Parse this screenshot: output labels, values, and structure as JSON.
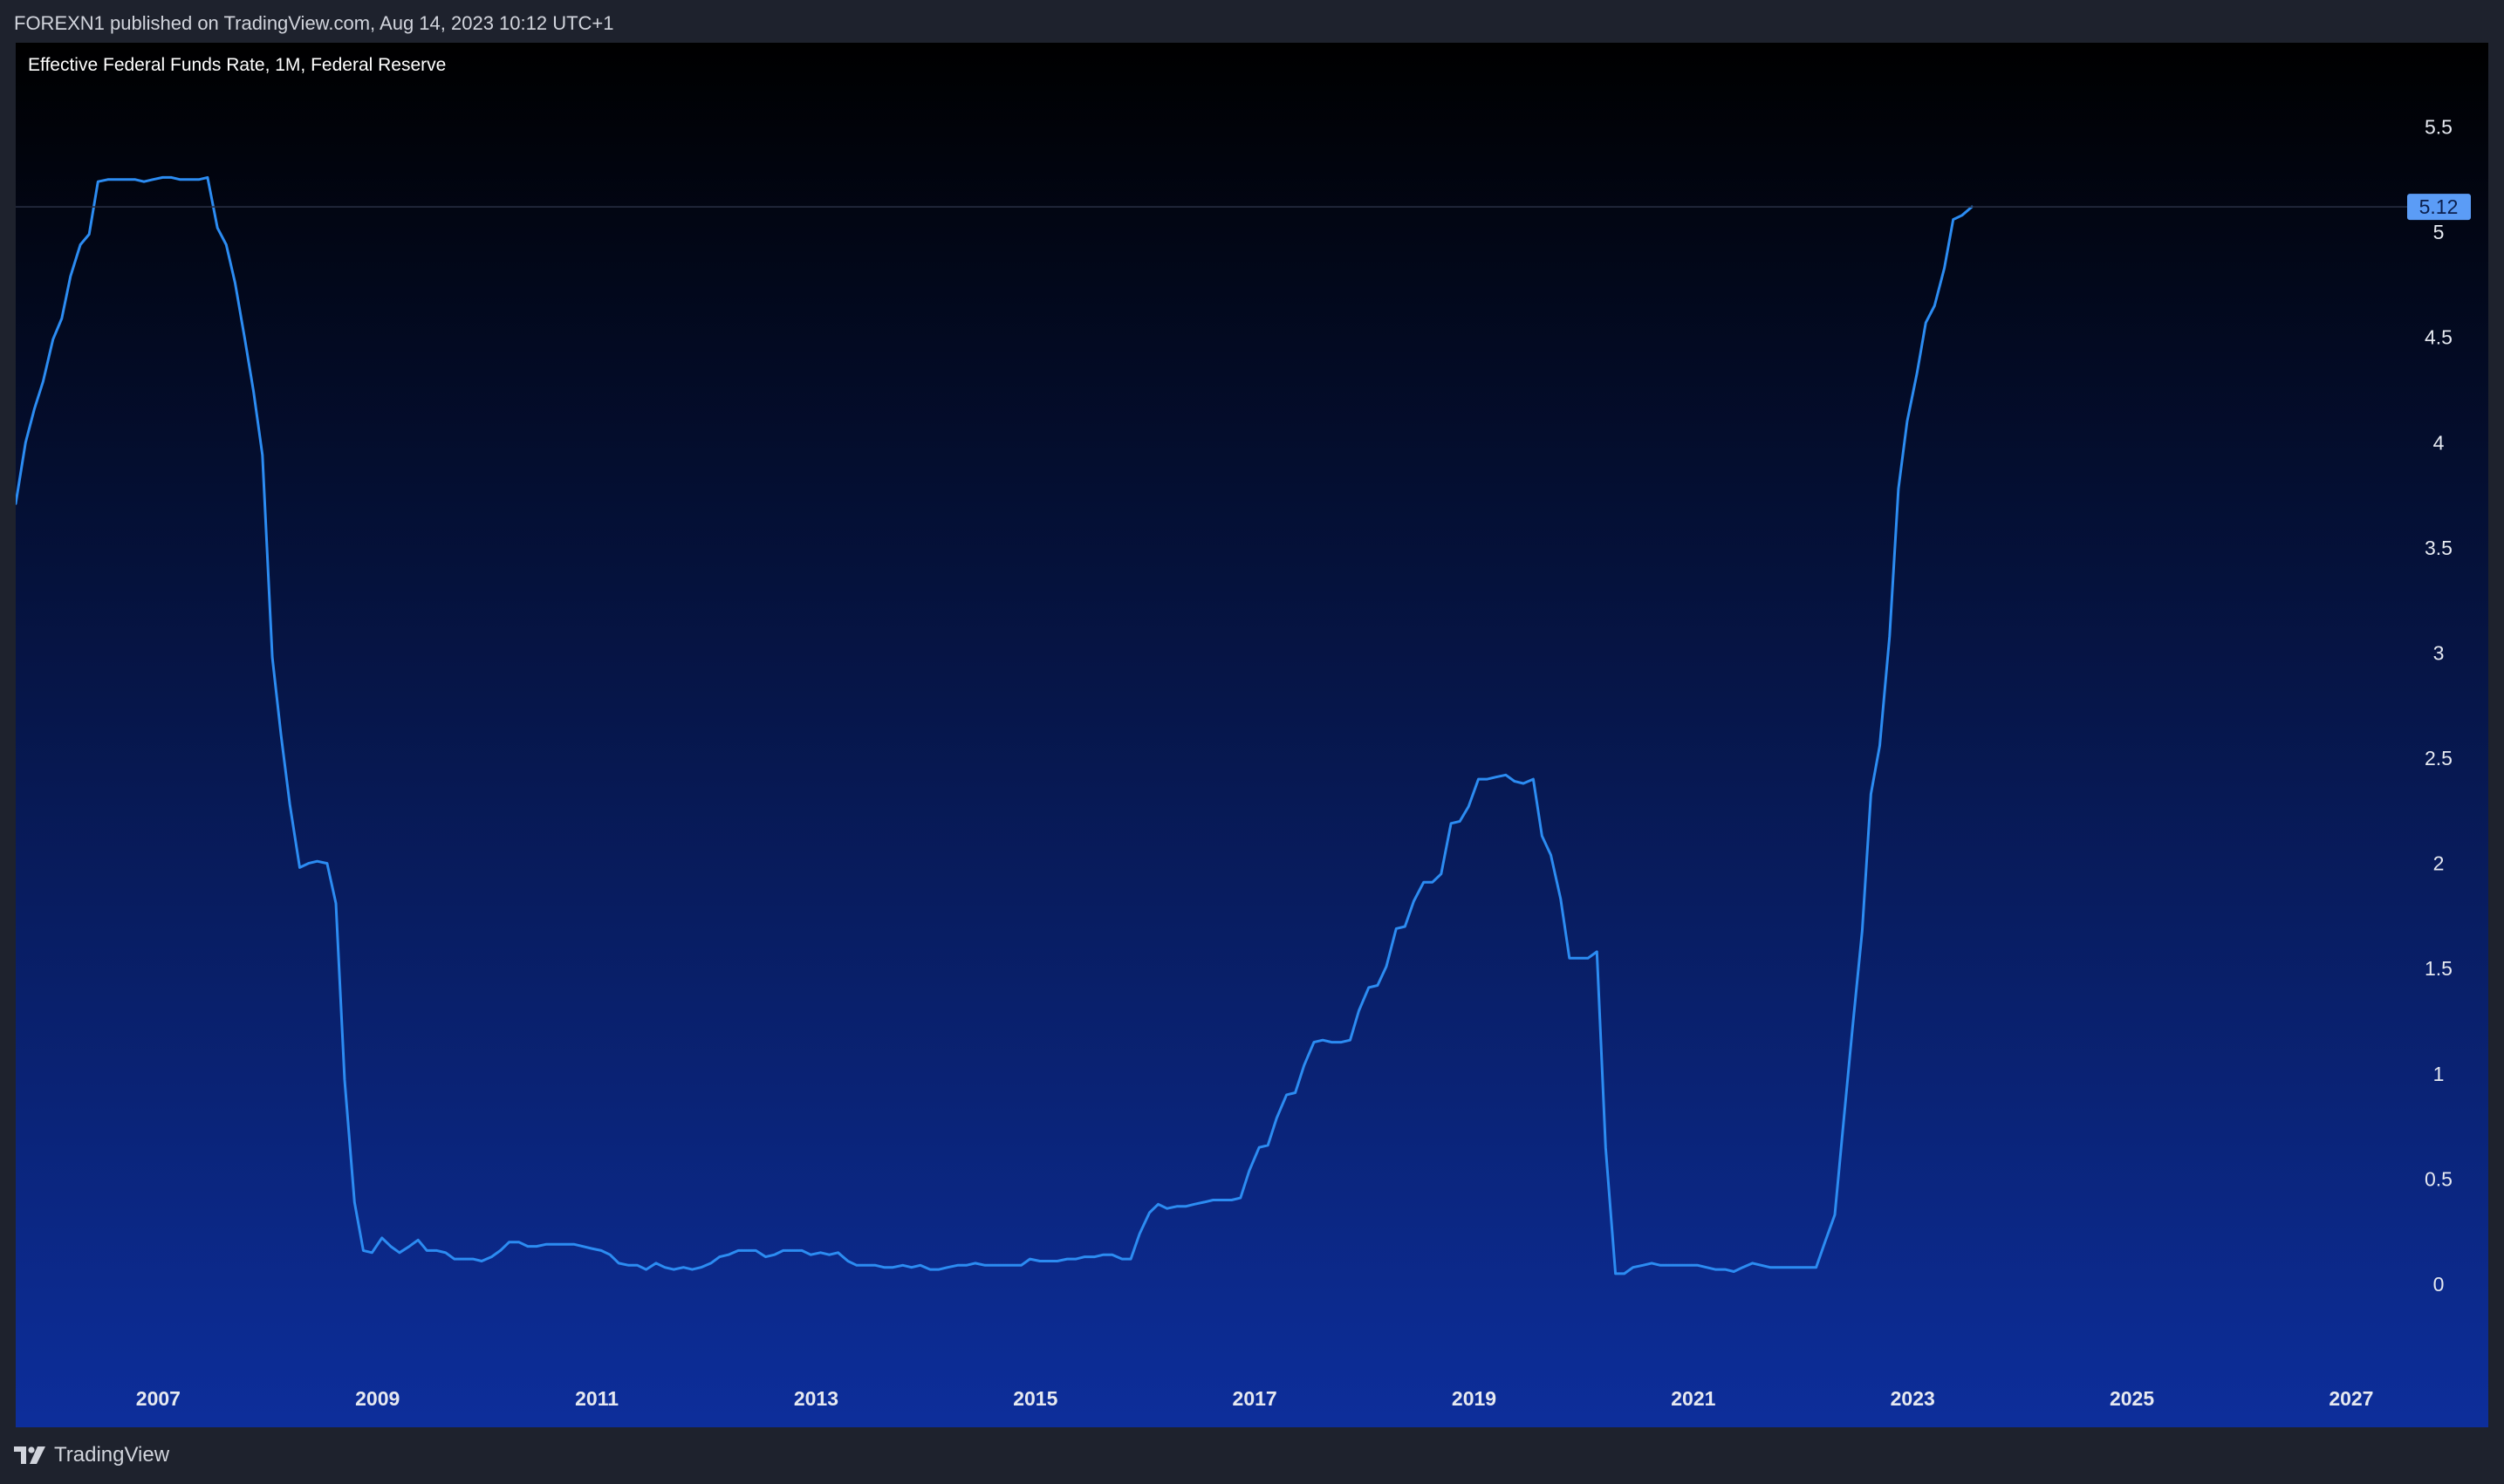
{
  "header": {
    "publish_text": "FOREXN1 published on TradingView.com, Aug 14, 2023 10:12 UTC+1"
  },
  "footer": {
    "brand": "TradingView",
    "logo_mark": "TV"
  },
  "colors": {
    "background_top": "#000000",
    "background_bottom": "#0d2e9b",
    "line": "#2c8cf2",
    "axis_text": "#e6e9f0",
    "price_label_bg": "#5b9cf6",
    "price_label_text": "#0b1f4d",
    "frame": "#1e222d"
  },
  "chart_data": {
    "type": "line",
    "title": "Effective Federal Funds Rate, 1M, Federal Reserve",
    "xlabel": "",
    "ylabel": "",
    "x_ticks": [
      "2007",
      "2009",
      "2011",
      "2013",
      "2015",
      "2017",
      "2019",
      "2021",
      "2023",
      "2025",
      "2027"
    ],
    "y_ticks": [
      "0",
      "0.5",
      "1",
      "1.5",
      "2",
      "2.5",
      "3",
      "3.5",
      "4",
      "4.5",
      "5",
      "5.5"
    ],
    "xlim": [
      2005.7,
      2028.25
    ],
    "ylim": [
      -0.68,
      5.9
    ],
    "last_value_label": "5.12",
    "last_value": 5.12,
    "grid": false,
    "series": [
      {
        "points": [
          [
            2005.7,
            3.71
          ],
          [
            2005.79,
            4.0
          ],
          [
            2005.87,
            4.16
          ],
          [
            2005.95,
            4.29
          ],
          [
            2006.04,
            4.49
          ],
          [
            2006.12,
            4.59
          ],
          [
            2006.2,
            4.79
          ],
          [
            2006.29,
            4.94
          ],
          [
            2006.37,
            4.99
          ],
          [
            2006.45,
            5.24
          ],
          [
            2006.54,
            5.25
          ],
          [
            2006.62,
            5.25
          ],
          [
            2006.7,
            5.25
          ],
          [
            2006.79,
            5.25
          ],
          [
            2006.87,
            5.24
          ],
          [
            2006.95,
            5.25
          ],
          [
            2007.04,
            5.26
          ],
          [
            2007.12,
            5.26
          ],
          [
            2007.2,
            5.25
          ],
          [
            2007.29,
            5.25
          ],
          [
            2007.37,
            5.25
          ],
          [
            2007.45,
            5.26
          ],
          [
            2007.54,
            5.02
          ],
          [
            2007.62,
            4.94
          ],
          [
            2007.7,
            4.76
          ],
          [
            2007.79,
            4.49
          ],
          [
            2007.87,
            4.24
          ],
          [
            2007.95,
            3.94
          ],
          [
            2008.04,
            2.98
          ],
          [
            2008.12,
            2.61
          ],
          [
            2008.2,
            2.28
          ],
          [
            2008.29,
            1.98
          ],
          [
            2008.37,
            2.0
          ],
          [
            2008.45,
            2.01
          ],
          [
            2008.54,
            2.0
          ],
          [
            2008.62,
            1.81
          ],
          [
            2008.7,
            0.97
          ],
          [
            2008.79,
            0.39
          ],
          [
            2008.87,
            0.16
          ],
          [
            2008.95,
            0.15
          ],
          [
            2009.04,
            0.22
          ],
          [
            2009.12,
            0.18
          ],
          [
            2009.2,
            0.15
          ],
          [
            2009.29,
            0.18
          ],
          [
            2009.37,
            0.21
          ],
          [
            2009.45,
            0.16
          ],
          [
            2009.54,
            0.16
          ],
          [
            2009.62,
            0.15
          ],
          [
            2009.7,
            0.12
          ],
          [
            2009.79,
            0.12
          ],
          [
            2009.87,
            0.12
          ],
          [
            2009.95,
            0.11
          ],
          [
            2010.04,
            0.13
          ],
          [
            2010.12,
            0.16
          ],
          [
            2010.2,
            0.2
          ],
          [
            2010.29,
            0.2
          ],
          [
            2010.37,
            0.18
          ],
          [
            2010.45,
            0.18
          ],
          [
            2010.54,
            0.19
          ],
          [
            2010.62,
            0.19
          ],
          [
            2010.7,
            0.19
          ],
          [
            2010.79,
            0.19
          ],
          [
            2010.87,
            0.18
          ],
          [
            2010.95,
            0.17
          ],
          [
            2011.04,
            0.16
          ],
          [
            2011.12,
            0.14
          ],
          [
            2011.2,
            0.1
          ],
          [
            2011.29,
            0.09
          ],
          [
            2011.37,
            0.09
          ],
          [
            2011.45,
            0.07
          ],
          [
            2011.54,
            0.1
          ],
          [
            2011.62,
            0.08
          ],
          [
            2011.7,
            0.07
          ],
          [
            2011.79,
            0.08
          ],
          [
            2011.87,
            0.07
          ],
          [
            2011.95,
            0.08
          ],
          [
            2012.04,
            0.1
          ],
          [
            2012.12,
            0.13
          ],
          [
            2012.2,
            0.14
          ],
          [
            2012.29,
            0.16
          ],
          [
            2012.37,
            0.16
          ],
          [
            2012.45,
            0.16
          ],
          [
            2012.54,
            0.13
          ],
          [
            2012.62,
            0.14
          ],
          [
            2012.7,
            0.16
          ],
          [
            2012.79,
            0.16
          ],
          [
            2012.87,
            0.16
          ],
          [
            2012.95,
            0.14
          ],
          [
            2013.04,
            0.15
          ],
          [
            2013.12,
            0.14
          ],
          [
            2013.2,
            0.15
          ],
          [
            2013.29,
            0.11
          ],
          [
            2013.37,
            0.09
          ],
          [
            2013.45,
            0.09
          ],
          [
            2013.54,
            0.09
          ],
          [
            2013.62,
            0.08
          ],
          [
            2013.7,
            0.08
          ],
          [
            2013.79,
            0.09
          ],
          [
            2013.87,
            0.08
          ],
          [
            2013.95,
            0.09
          ],
          [
            2014.04,
            0.07
          ],
          [
            2014.12,
            0.07
          ],
          [
            2014.2,
            0.08
          ],
          [
            2014.29,
            0.09
          ],
          [
            2014.37,
            0.09
          ],
          [
            2014.45,
            0.1
          ],
          [
            2014.54,
            0.09
          ],
          [
            2014.62,
            0.09
          ],
          [
            2014.7,
            0.09
          ],
          [
            2014.79,
            0.09
          ],
          [
            2014.87,
            0.09
          ],
          [
            2014.95,
            0.12
          ],
          [
            2015.04,
            0.11
          ],
          [
            2015.12,
            0.11
          ],
          [
            2015.2,
            0.11
          ],
          [
            2015.29,
            0.12
          ],
          [
            2015.37,
            0.12
          ],
          [
            2015.45,
            0.13
          ],
          [
            2015.54,
            0.13
          ],
          [
            2015.62,
            0.14
          ],
          [
            2015.7,
            0.14
          ],
          [
            2015.79,
            0.12
          ],
          [
            2015.87,
            0.12
          ],
          [
            2015.95,
            0.24
          ],
          [
            2016.04,
            0.34
          ],
          [
            2016.12,
            0.38
          ],
          [
            2016.2,
            0.36
          ],
          [
            2016.29,
            0.37
          ],
          [
            2016.37,
            0.37
          ],
          [
            2016.45,
            0.38
          ],
          [
            2016.54,
            0.39
          ],
          [
            2016.62,
            0.4
          ],
          [
            2016.7,
            0.4
          ],
          [
            2016.79,
            0.4
          ],
          [
            2016.87,
            0.41
          ],
          [
            2016.95,
            0.54
          ],
          [
            2017.04,
            0.65
          ],
          [
            2017.12,
            0.66
          ],
          [
            2017.2,
            0.79
          ],
          [
            2017.29,
            0.9
          ],
          [
            2017.37,
            0.91
          ],
          [
            2017.45,
            1.04
          ],
          [
            2017.54,
            1.15
          ],
          [
            2017.62,
            1.16
          ],
          [
            2017.7,
            1.15
          ],
          [
            2017.79,
            1.15
          ],
          [
            2017.87,
            1.16
          ],
          [
            2017.95,
            1.3
          ],
          [
            2018.04,
            1.41
          ],
          [
            2018.12,
            1.42
          ],
          [
            2018.2,
            1.51
          ],
          [
            2018.29,
            1.69
          ],
          [
            2018.37,
            1.7
          ],
          [
            2018.45,
            1.82
          ],
          [
            2018.54,
            1.91
          ],
          [
            2018.62,
            1.91
          ],
          [
            2018.7,
            1.95
          ],
          [
            2018.79,
            2.19
          ],
          [
            2018.87,
            2.2
          ],
          [
            2018.95,
            2.27
          ],
          [
            2019.04,
            2.4
          ],
          [
            2019.12,
            2.4
          ],
          [
            2019.2,
            2.41
          ],
          [
            2019.29,
            2.42
          ],
          [
            2019.37,
            2.39
          ],
          [
            2019.45,
            2.38
          ],
          [
            2019.54,
            2.4
          ],
          [
            2019.62,
            2.13
          ],
          [
            2019.7,
            2.04
          ],
          [
            2019.79,
            1.83
          ],
          [
            2019.87,
            1.55
          ],
          [
            2019.95,
            1.55
          ],
          [
            2020.04,
            1.55
          ],
          [
            2020.12,
            1.58
          ],
          [
            2020.2,
            0.65
          ],
          [
            2020.29,
            0.05
          ],
          [
            2020.37,
            0.05
          ],
          [
            2020.45,
            0.08
          ],
          [
            2020.54,
            0.09
          ],
          [
            2020.62,
            0.1
          ],
          [
            2020.7,
            0.09
          ],
          [
            2020.79,
            0.09
          ],
          [
            2020.87,
            0.09
          ],
          [
            2020.95,
            0.09
          ],
          [
            2021.04,
            0.09
          ],
          [
            2021.12,
            0.08
          ],
          [
            2021.2,
            0.07
          ],
          [
            2021.29,
            0.07
          ],
          [
            2021.37,
            0.06
          ],
          [
            2021.45,
            0.08
          ],
          [
            2021.54,
            0.1
          ],
          [
            2021.62,
            0.09
          ],
          [
            2021.7,
            0.08
          ],
          [
            2021.79,
            0.08
          ],
          [
            2021.87,
            0.08
          ],
          [
            2021.95,
            0.08
          ],
          [
            2022.04,
            0.08
          ],
          [
            2022.12,
            0.08
          ],
          [
            2022.2,
            0.2
          ],
          [
            2022.29,
            0.33
          ],
          [
            2022.37,
            0.77
          ],
          [
            2022.45,
            1.21
          ],
          [
            2022.54,
            1.68
          ],
          [
            2022.62,
            2.33
          ],
          [
            2022.7,
            2.56
          ],
          [
            2022.79,
            3.08
          ],
          [
            2022.87,
            3.78
          ],
          [
            2022.95,
            4.1
          ],
          [
            2023.04,
            4.33
          ],
          [
            2023.12,
            4.57
          ],
          [
            2023.2,
            4.65
          ],
          [
            2023.29,
            4.83
          ],
          [
            2023.37,
            5.06
          ],
          [
            2023.45,
            5.08
          ],
          [
            2023.54,
            5.12
          ]
        ]
      }
    ]
  }
}
